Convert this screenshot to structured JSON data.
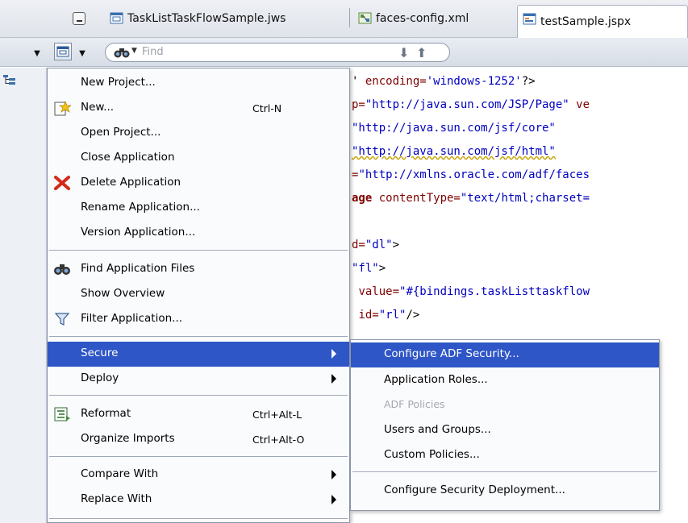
{
  "tabs": [
    {
      "label": "TaskListTaskFlowSample.jws",
      "icon": "workspace-icon"
    },
    {
      "label": "faces-config.xml",
      "icon": "diagram-icon"
    },
    {
      "label": "testSample.jspx",
      "icon": "jspx-file-icon",
      "active": true
    }
  ],
  "toolbar": {
    "find_placeholder": "Find"
  },
  "editor": {
    "lines": [
      {
        "a": "' ",
        "b": "encoding=",
        "c": "'windows-1252'",
        "d": "?>"
      },
      {
        "a": "p=",
        "b": "",
        "c": "\"http://java.sun.com/JSP/Page\"",
        "d": " ve"
      },
      {
        "a": "",
        "b": "",
        "c": "\"http://java.sun.com/jsf/core\"",
        "d": ""
      },
      {
        "a": "",
        "b": "",
        "c": "\"http://java.sun.com/jsf/html\"",
        "d": ""
      },
      {
        "a": "=",
        "b": "",
        "c": "\"http://xmlns.oracle.com/adf/faces",
        "d": ""
      },
      {
        "a": "age ",
        "b": "contentType=",
        "c": "\"text/html;charset=",
        "d": ""
      },
      {
        "a": "d=",
        "b": "",
        "c": "\"dl\"",
        "d": ">"
      },
      {
        "a": "",
        "b": "",
        "c": "\"fl\"",
        "d": ">"
      },
      {
        "a": " ",
        "b": "value=",
        "c": "\"#{bindings.taskListtaskflow",
        "d": ""
      },
      {
        "a": " ",
        "b": "id=",
        "c": "\"rl\"",
        "d": "/>"
      }
    ]
  },
  "menu": {
    "items": [
      {
        "label": "New Project...",
        "shortcut": ""
      },
      {
        "label": "New...",
        "shortcut": "Ctrl-N"
      },
      {
        "label": "Open Project...",
        "shortcut": ""
      },
      {
        "label": "Close Application",
        "shortcut": ""
      },
      {
        "label": "Delete Application",
        "shortcut": ""
      },
      {
        "label": "Rename Application...",
        "shortcut": ""
      },
      {
        "label": "Version Application...",
        "shortcut": ""
      },
      {
        "label": "Find Application Files",
        "shortcut": ""
      },
      {
        "label": "Show Overview",
        "shortcut": ""
      },
      {
        "label": "Filter Application...",
        "shortcut": ""
      },
      {
        "label": "Secure",
        "shortcut": ""
      },
      {
        "label": "Deploy",
        "shortcut": ""
      },
      {
        "label": "Reformat",
        "shortcut": "Ctrl+Alt-L"
      },
      {
        "label": "Organize Imports",
        "shortcut": "Ctrl+Alt-O"
      },
      {
        "label": "Compare With",
        "shortcut": ""
      },
      {
        "label": "Replace With",
        "shortcut": ""
      }
    ]
  },
  "submenu": {
    "items": [
      {
        "label": "Configure ADF Security..."
      },
      {
        "label": "Application Roles..."
      },
      {
        "label": "ADF Policies"
      },
      {
        "label": "Users and Groups..."
      },
      {
        "label": "Custom Policies..."
      },
      {
        "label": "Configure Security Deployment..."
      }
    ]
  },
  "colors": {
    "selection": "#2e56c6",
    "disabled_text": "#a3a8b0",
    "string": "#0000c0",
    "attribute": "#800000"
  }
}
